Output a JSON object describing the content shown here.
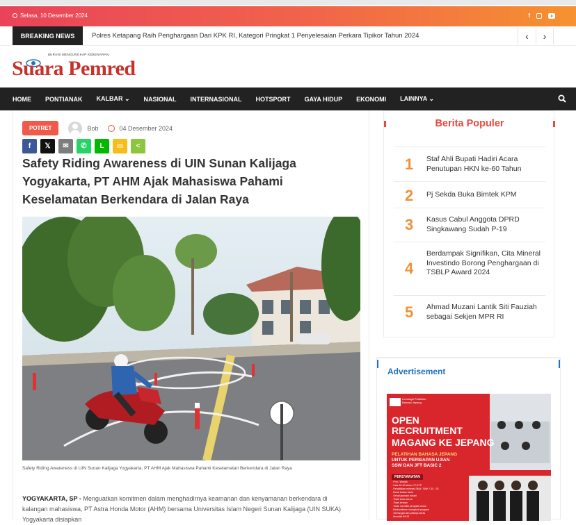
{
  "topbar": {
    "date": "Selasa, 10 Desember 2024",
    "social": [
      "f",
      "ig",
      "yt"
    ]
  },
  "breaking": {
    "label": "BREAKING NEWS",
    "text": "Polres Ketapang Raih Penghargaan Dari KPK RI, Kategori Pringkat 1 Penyelesaian Perkara Tipikor Tahun 2024",
    "prev": "‹",
    "next": "›"
  },
  "logo": {
    "tagline": "BERANI MENGUNGKAP KEBENARAN",
    "name": "Suara Pemred"
  },
  "nav": {
    "items": [
      "HOME",
      "PONTIANAK",
      "KALBAR ⌄",
      "NASIONAL",
      "INTERNASIONAL",
      "HOTSPORT",
      "GAYA HIDUP",
      "EKONOMI",
      "LAINNYA ⌄"
    ]
  },
  "article": {
    "category": "POTRET",
    "author": "Bob",
    "date": "04 Desember 2024",
    "title": "Safety Riding Awareness di UIN Sunan Kalijaga Yogyakarta, PT AHM Ajak Mahasiswa Pahami Keselamatan Berkendara di Jalan Raya",
    "caption": "Safety Riding Awareness di UIN Sunan Kalijaga Yogyakarta, PT AHM Ajak Mahasiswa Pahami Keselamatan Berkendara di Jalan Raya",
    "lead_place": "YOGYAKARTA, SP - ",
    "lead_text": "Menguatkan komitmen dalam menghadirnya keamanan dan kenyamanan berkendara di kalangan mahasiswa, PT Astra Honda Motor (AHM) bersama Universitas Islam Negeri Sunan Kalijaga (UIN SUKA) Yogyakarta disiapkan"
  },
  "share": [
    {
      "name": "facebook",
      "glyph": "f",
      "color": "#3b5998"
    },
    {
      "name": "x",
      "glyph": "𝕏",
      "color": "#111111"
    },
    {
      "name": "email",
      "glyph": "✉",
      "color": "#7d7d7d"
    },
    {
      "name": "whatsapp",
      "glyph": "✆",
      "color": "#25d366"
    },
    {
      "name": "line",
      "glyph": "L",
      "color": "#00b900"
    },
    {
      "name": "sms",
      "glyph": "▭",
      "color": "#f6bd1b"
    },
    {
      "name": "share",
      "glyph": "<",
      "color": "#8cc63f"
    }
  ],
  "popular": {
    "title": "Berita Populer",
    "items": [
      {
        "num": "1",
        "title": "Staf Ahli Bupati Hadiri Acara Penutupan HKN ke-60 Tahun"
      },
      {
        "num": "2",
        "title": "Pj Sekda Buka Bimtek KPM"
      },
      {
        "num": "3",
        "title": "Kasus Cabul Anggota DPRD Singkawang Sudah P-19"
      },
      {
        "num": "4",
        "title": "Berdampak Signifikan, Cita Mineral Investindo Borong Penghargaan di TSBLP Award 2024"
      },
      {
        "num": "5",
        "title": "Ahmad Muzani Lantik Siti Fauziah sebagai Sekjen MPR RI"
      }
    ]
  },
  "ad": {
    "title": "Advertisement",
    "org": "Lembaga Pelatihan Bahasa Jepang",
    "headline1": "OPEN",
    "headline2": "RECRUITMENT",
    "headline3": "MAGANG KE JEPANG",
    "sub1": "PELATIHAN BAHASA JEPANG",
    "sub2": "UNTUK PERSIAPAN UJIAN",
    "sub3": "SSW DAN JFT BASIC 2",
    "req_title": "PERSYARATAN",
    "reqs": [
      "- Pria / Wanita",
      "- Usia 18-30 tahun / E-KTP",
      "- Pendidikan minimal SMA / SMK / D3 - S1",
      "- Berat badan ideal",
      "- Sehat jasmani rohani",
      "- Tidak buta warna",
      "- Tidak bertato",
      "- Tidak memiliki penyakit serius",
      "- Berkomitmen mengikuti program",
      "- Semangat dan pekerja keras",
      "- Memiliki BPJS"
    ]
  }
}
